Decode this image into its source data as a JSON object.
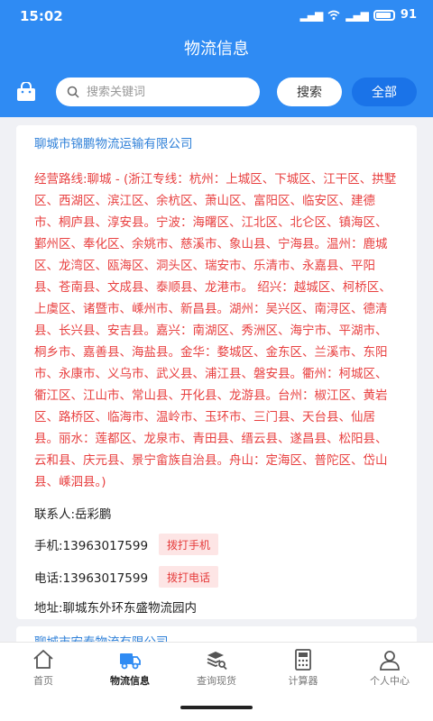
{
  "status_bar": {
    "time": "15:02",
    "battery": "91"
  },
  "header": {
    "title": "物流信息"
  },
  "search": {
    "placeholder": "搜索关键词",
    "value": "",
    "search_label": "搜索",
    "all_label": "全部"
  },
  "listing": {
    "company": "聊城市锦鹏物流运输有限公司",
    "route": "经营路线:聊城 - (浙江专线：杭州：上城区、下城区、江干区、拱墅区、西湖区、滨江区、余杭区、萧山区、富阳区、临安区、建德市、桐庐县、淳安县。宁波：海曙区、江北区、北仑区、镇海区、鄞州区、奉化区、余姚市、慈溪市、象山县、宁海县。温州：鹿城区、龙湾区、瓯海区、洞头区、瑞安市、乐清市、永嘉县、平阳县、苍南县、文成县、泰顺县、龙港市。 绍兴：越城区、柯桥区、上虞区、诸暨市、嵊州市、新昌县。湖州：吴兴区、南浔区、德清县、长兴县、安吉县。嘉兴：南湖区、秀洲区、海宁市、平湖市、桐乡市、嘉善县、海盐县。金华：婺城区、金东区、兰溪市、东阳市、永康市、义乌市、武义县、浦江县、磐安县。衢州：柯城区、衢江区、江山市、常山县、开化县、龙游县。台州：椒江区、黄岩区、路桥区、临海市、温岭市、玉环市、三门县、天台县、仙居县。丽水：莲都区、龙泉市、青田县、缙云县、遂昌县、松阳县、云和县、庆元县、景宁畲族自治县。舟山：定海区、普陀区、岱山县、嵊泗县。)",
    "contact": "联系人:岳彩鹏",
    "mobile": "手机:13963017599",
    "mobile_button": "拨打手机",
    "phone": "电话:13963017599",
    "phone_button": "拨打电话",
    "address": "地址:聊城东外环东盛物流园内"
  },
  "next_listing": {
    "company": "聊城市宏泰物流有限公司"
  },
  "tabbar": {
    "items": [
      {
        "label": "首页",
        "icon": "home-icon"
      },
      {
        "label": "物流信息",
        "icon": "truck-icon"
      },
      {
        "label": "查询现货",
        "icon": "stack-search-icon"
      },
      {
        "label": "计算器",
        "icon": "calculator-icon"
      },
      {
        "label": "个人中心",
        "icon": "user-icon"
      }
    ],
    "active_index": 1
  },
  "colors": {
    "primary": "#2f8bf3",
    "accent_button": "#1a73e8",
    "company_text": "#2f80d8",
    "route_text": "#e84040",
    "call_button_bg": "#fde5e5"
  }
}
